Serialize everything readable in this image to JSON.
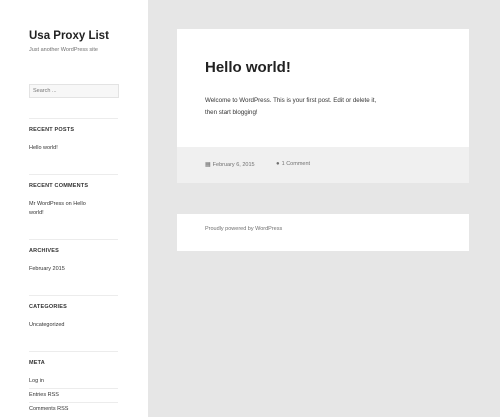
{
  "site": {
    "title": "Usa Proxy List",
    "description": "Just another WordPress site"
  },
  "search": {
    "placeholder": "Search ..."
  },
  "widgets": {
    "recent_posts": {
      "title": "RECENT POSTS",
      "items": [
        "Hello world!"
      ]
    },
    "recent_comments": {
      "title": "RECENT COMMENTS",
      "author": "Mr WordPress",
      "on": " on ",
      "post_line1": "Hello",
      "post_line2": "world!"
    },
    "archives": {
      "title": "ARCHIVES",
      "items": [
        "February 2015"
      ]
    },
    "categories": {
      "title": "CATEGORIES",
      "items": [
        "Uncategorized"
      ]
    },
    "meta": {
      "title": "META",
      "items": [
        "Log in",
        "Entries RSS",
        "Comments RSS"
      ]
    }
  },
  "post": {
    "title": "Hello world!",
    "body_line1": "Welcome to WordPress. This is your first post. Edit or delete it,",
    "body_line2": "then start blogging!",
    "date": "February 6, 2015",
    "comments": "1 Comment"
  },
  "footer": {
    "credit": "Proudly powered by WordPress"
  },
  "icons": {
    "date": "calendar-icon",
    "comments": "comment-icon"
  }
}
